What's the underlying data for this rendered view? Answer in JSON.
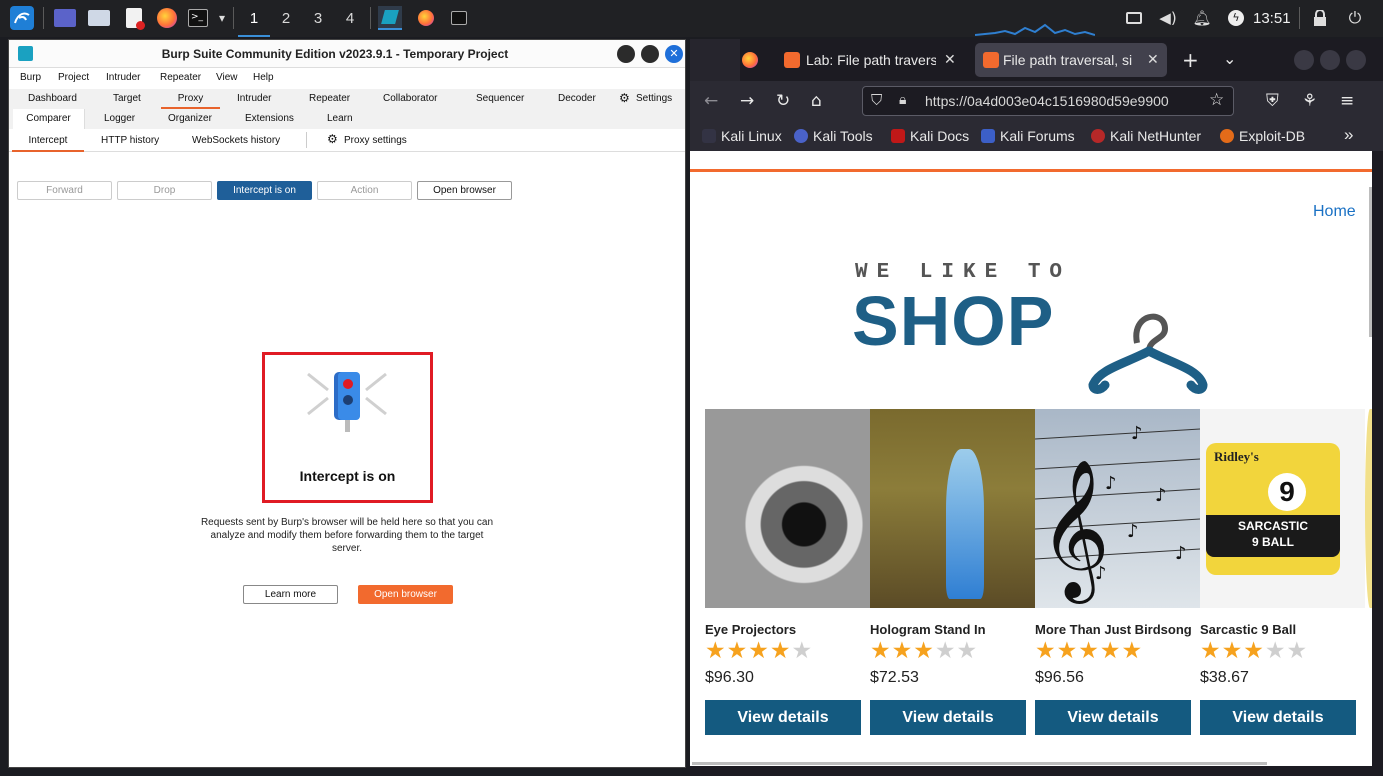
{
  "taskbar": {
    "workspaces": [
      "1",
      "2",
      "3",
      "4"
    ],
    "active_workspace": "1",
    "clock": "13:51"
  },
  "burp": {
    "window_title": "Burp Suite Community Edition v2023.9.1 - Temporary Project",
    "menu": [
      "Burp",
      "Project",
      "Intruder",
      "Repeater",
      "View",
      "Help"
    ],
    "tabs_row1": [
      "Dashboard",
      "Target",
      "Proxy",
      "Intruder",
      "Repeater",
      "Collaborator",
      "Sequencer",
      "Decoder"
    ],
    "settings_label": "Settings",
    "tabs_row2": [
      "Comparer",
      "Logger",
      "Organizer",
      "Extensions",
      "Learn"
    ],
    "active_tab": "Proxy",
    "subtabs": [
      "Intercept",
      "HTTP history",
      "WebSockets history"
    ],
    "proxy_settings_label": "Proxy settings",
    "buttons": {
      "forward": "Forward",
      "drop": "Drop",
      "intercept": "Intercept is on",
      "action": "Action",
      "open_browser": "Open browser"
    },
    "intercept_title": "Intercept is on",
    "intercept_description": "Requests sent by Burp's browser will be held here so that you can analyze and modify them before forwarding them to the target server.",
    "learn_more": "Learn more",
    "open_browser_cta": "Open browser",
    "accent_color": "#f26a2e"
  },
  "firefox": {
    "tabs": [
      {
        "title": "",
        "icon": "firefox-icon"
      },
      {
        "title": "Lab: File path traversal, simple case",
        "icon": "portswigger-icon"
      },
      {
        "title": "File path traversal, simple case",
        "icon": "portswigger-icon"
      }
    ],
    "url": "https://0a4d003e04c1516980d59e9900",
    "bookmarks": [
      "Kali Linux",
      "Kali Tools",
      "Kali Docs",
      "Kali Forums",
      "Kali NetHunter",
      "Exploit-DB"
    ]
  },
  "shop": {
    "home_link": "Home",
    "logo_small": "WE LIKE TO",
    "logo_big": "SHOP",
    "brand_color": "#145a80",
    "star_color": "#f6a21e",
    "products": [
      {
        "name": "Eye Projectors",
        "rating": 4,
        "price": "$96.30",
        "button": "View details"
      },
      {
        "name": "Hologram Stand In",
        "rating": 3,
        "price": "$72.53",
        "button": "View details"
      },
      {
        "name": "More Than Just Birdsong",
        "rating": 5,
        "price": "$96.56",
        "button": "View details"
      },
      {
        "name": "Sarcastic 9 Ball",
        "rating": 3,
        "price": "$38.67",
        "button": "View details"
      }
    ],
    "product_image_text": {
      "ridleys": "Ridley's",
      "nine": "9",
      "sarcastic": "SARCASTIC",
      "nine_ball": "9 BALL"
    }
  }
}
